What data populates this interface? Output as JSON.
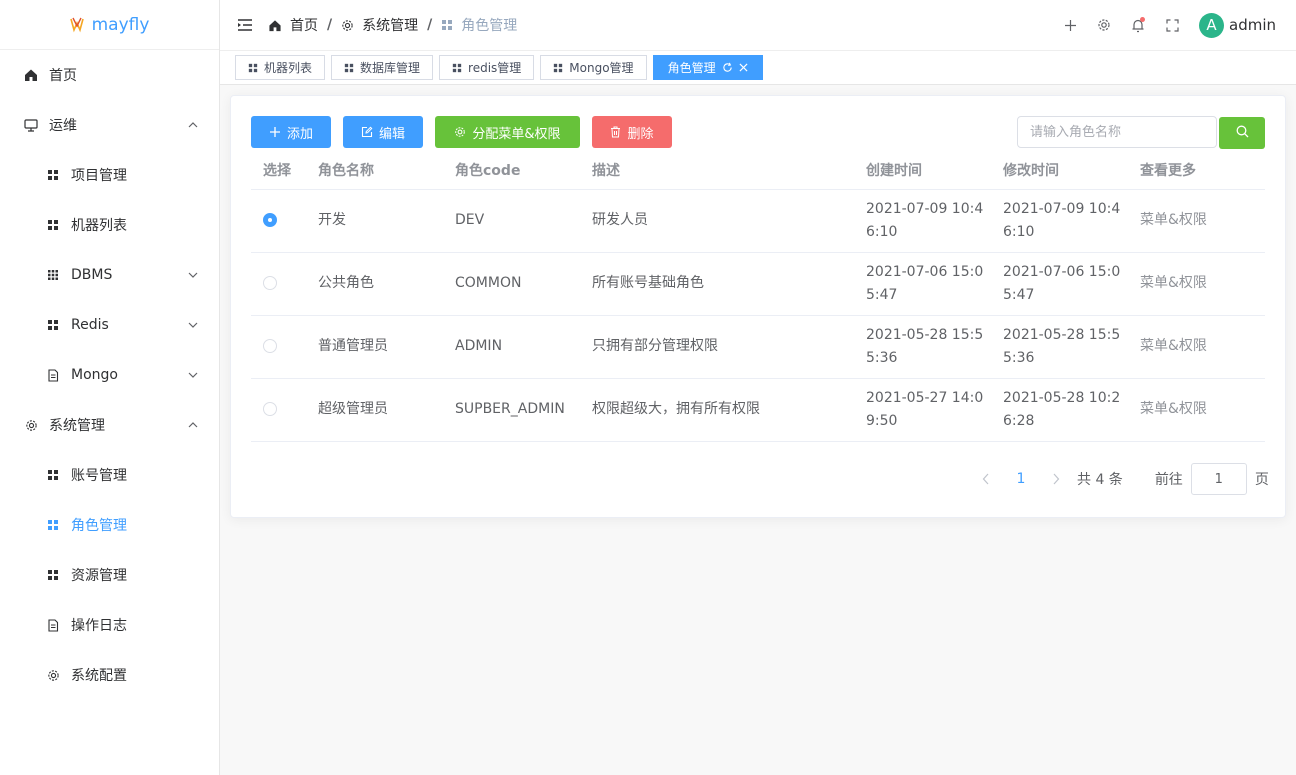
{
  "app": {
    "name": "mayfly"
  },
  "sidebar": {
    "items": [
      {
        "label": "首页",
        "icon": "home-icon",
        "level": 1
      },
      {
        "label": "运维",
        "icon": "monitor-icon",
        "level": 1,
        "expanded": true
      },
      {
        "label": "项目管理",
        "icon": "grid-icon",
        "level": 2
      },
      {
        "label": "机器列表",
        "icon": "grid-icon",
        "level": 2
      },
      {
        "label": "DBMS",
        "icon": "database-icon",
        "level": 2,
        "expanded": false
      },
      {
        "label": "Redis",
        "icon": "grid-icon",
        "level": 2,
        "expanded": false
      },
      {
        "label": "Mongo",
        "icon": "document-icon",
        "level": 2,
        "expanded": false
      },
      {
        "label": "系统管理",
        "icon": "gear-icon",
        "level": 1,
        "expanded": true
      },
      {
        "label": "账号管理",
        "icon": "grid-icon",
        "level": 2
      },
      {
        "label": "角色管理",
        "icon": "grid-icon",
        "level": 2,
        "active": true
      },
      {
        "label": "资源管理",
        "icon": "grid-icon",
        "level": 2
      },
      {
        "label": "操作日志",
        "icon": "document-icon",
        "level": 2
      },
      {
        "label": "系统配置",
        "icon": "gear-icon",
        "level": 2
      }
    ]
  },
  "header": {
    "breadcrumb": [
      "首页",
      "系统管理",
      "角色管理"
    ],
    "user": {
      "avatar_letter": "A",
      "name": "admin"
    }
  },
  "tags": [
    "机器列表",
    "数据库管理",
    "redis管理",
    "Mongo管理",
    "角色管理"
  ],
  "toolbar": {
    "add_label": "添加",
    "edit_label": "编辑",
    "assign_label": "分配菜单&权限",
    "delete_label": "删除",
    "search_placeholder": "请输入角色名称"
  },
  "table": {
    "columns": [
      "选择",
      "角色名称",
      "角色code",
      "描述",
      "创建时间",
      "修改时间",
      "查看更多"
    ],
    "rows": [
      {
        "selected": true,
        "name": "开发",
        "code": "DEV",
        "desc": "研发人员",
        "created_1": "2021-07-09 10:4",
        "created_2": "6:10",
        "updated_1": "2021-07-09 10:4",
        "updated_2": "6:10",
        "more": "菜单&权限"
      },
      {
        "selected": false,
        "name": "公共角色",
        "code": "COMMON",
        "desc": "所有账号基础角色",
        "created_1": "2021-07-06 15:0",
        "created_2": "5:47",
        "updated_1": "2021-07-06 15:0",
        "updated_2": "5:47",
        "more": "菜单&权限"
      },
      {
        "selected": false,
        "name": "普通管理员",
        "code": "ADMIN",
        "desc": "只拥有部分管理权限",
        "created_1": "2021-05-28 15:5",
        "created_2": "5:36",
        "updated_1": "2021-05-28 15:5",
        "updated_2": "5:36",
        "more": "菜单&权限"
      },
      {
        "selected": false,
        "name": "超级管理员",
        "code": "SUPBER_ADMIN",
        "desc": "权限超级大，拥有所有权限",
        "created_1": "2021-05-27 14:0",
        "created_2": "9:50",
        "updated_1": "2021-05-28 10:2",
        "updated_2": "6:28",
        "more": "菜单&权限"
      }
    ]
  },
  "pagination": {
    "current_page": "1",
    "total_text": "共 4 条",
    "goto_label": "前往",
    "goto_value": "1",
    "page_unit": "页"
  },
  "colors": {
    "primary": "#409eff",
    "success": "#67c23a",
    "danger": "#f56c6c",
    "avatar": "#2bb58a"
  }
}
